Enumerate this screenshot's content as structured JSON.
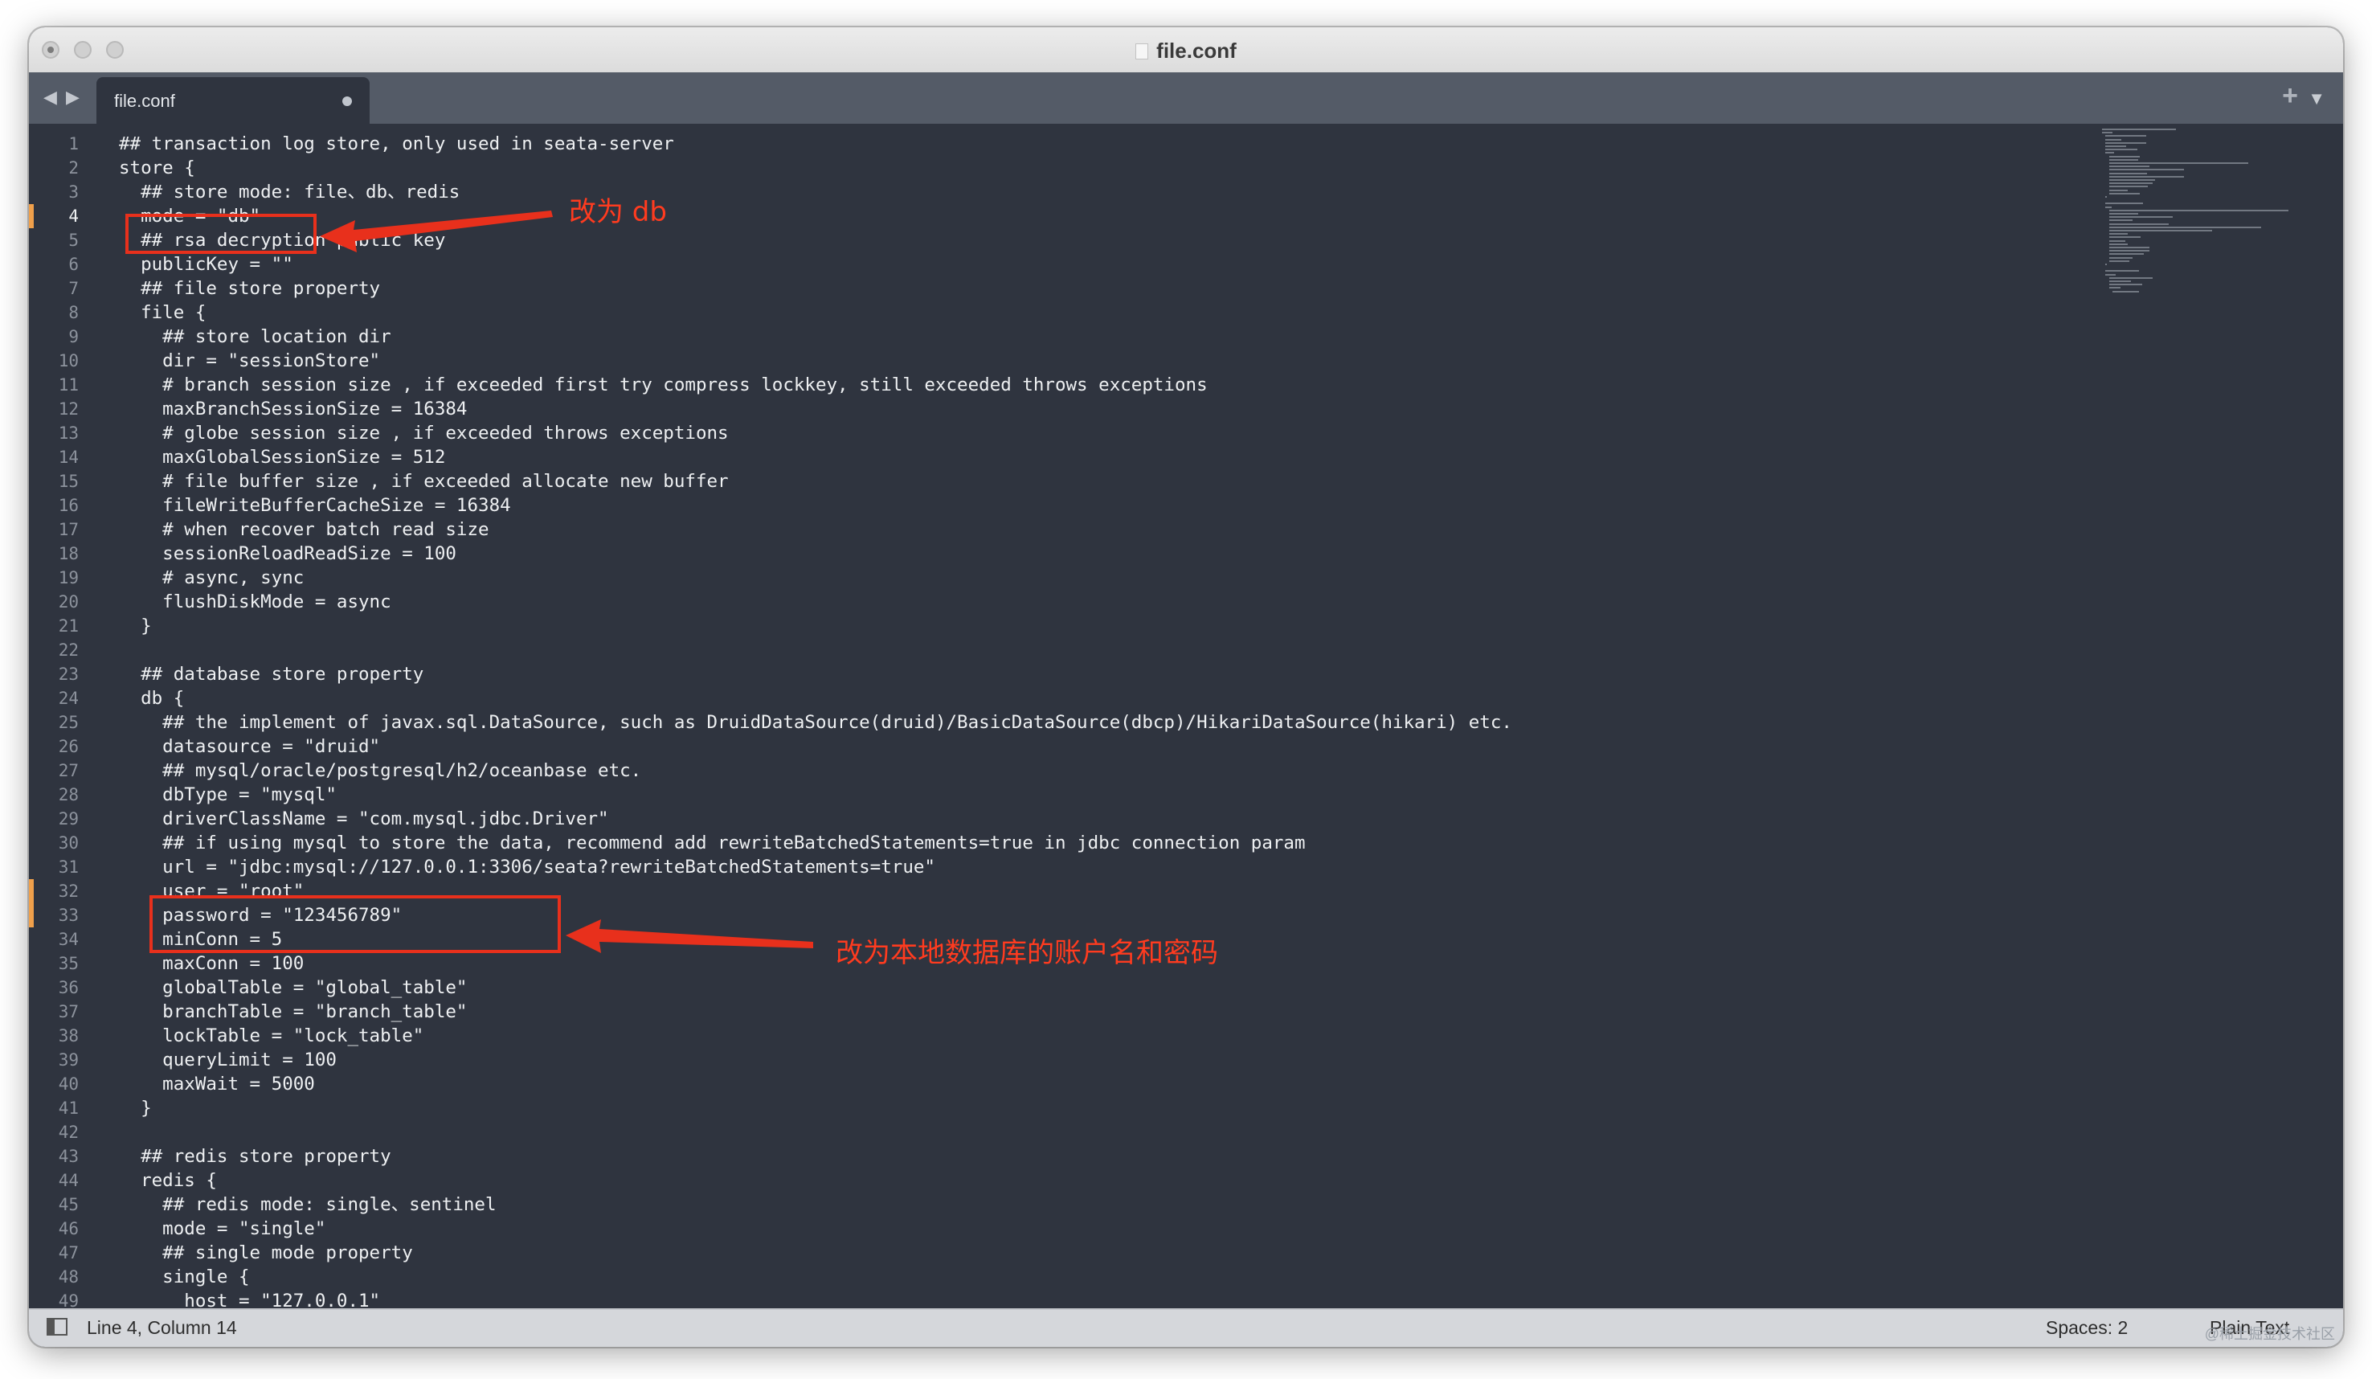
{
  "window": {
    "title": "file.conf"
  },
  "tabs": {
    "active_tab": "file.conf",
    "back_glyph": "◀",
    "forward_glyph": "▶",
    "new_tab_glyph": "+",
    "menu_glyph": "▼"
  },
  "editor": {
    "active_line": 4,
    "modified_lines": [
      4,
      32,
      33
    ],
    "lines": [
      "## transaction log store, only used in seata-server",
      "store {",
      "  ## store mode: file、db、redis",
      "  mode = \"db\"",
      "  ## rsa decryption public key",
      "  publicKey = \"\"",
      "  ## file store property",
      "  file {",
      "    ## store location dir",
      "    dir = \"sessionStore\"",
      "    # branch session size , if exceeded first try compress lockkey, still exceeded throws exceptions",
      "    maxBranchSessionSize = 16384",
      "    # globe session size , if exceeded throws exceptions",
      "    maxGlobalSessionSize = 512",
      "    # file buffer size , if exceeded allocate new buffer",
      "    fileWriteBufferCacheSize = 16384",
      "    # when recover batch read size",
      "    sessionReloadReadSize = 100",
      "    # async, sync",
      "    flushDiskMode = async",
      "  }",
      "",
      "  ## database store property",
      "  db {",
      "    ## the implement of javax.sql.DataSource, such as DruidDataSource(druid)/BasicDataSource(dbcp)/HikariDataSource(hikari) etc.",
      "    datasource = \"druid\"",
      "    ## mysql/oracle/postgresql/h2/oceanbase etc.",
      "    dbType = \"mysql\"",
      "    driverClassName = \"com.mysql.jdbc.Driver\"",
      "    ## if using mysql to store the data, recommend add rewriteBatchedStatements=true in jdbc connection param",
      "    url = \"jdbc:mysql://127.0.0.1:3306/seata?rewriteBatchedStatements=true\"",
      "    user = \"root\"",
      "    password = \"123456789\"",
      "    minConn = 5",
      "    maxConn = 100",
      "    globalTable = \"global_table\"",
      "    branchTable = \"branch_table\"",
      "    lockTable = \"lock_table\"",
      "    queryLimit = 100",
      "    maxWait = 5000",
      "  }",
      "",
      "  ## redis store property",
      "  redis {",
      "    ## redis mode: single、sentinel",
      "    mode = \"single\"",
      "    ## single mode property",
      "    single {",
      "      host = \"127.0.0.1\""
    ]
  },
  "annotations": {
    "mode_note": "改为 db",
    "credentials_note": "改为本地数据库的账户名和密码"
  },
  "status": {
    "position": "Line 4, Column 14",
    "indentation": "Spaces: 2",
    "syntax": "Plain Text",
    "watermark": "@稀土掘金技术社区"
  },
  "colors": {
    "editor_bg": "#2f343f",
    "annotation": "#e8301c",
    "modified": "#f0a04b"
  }
}
